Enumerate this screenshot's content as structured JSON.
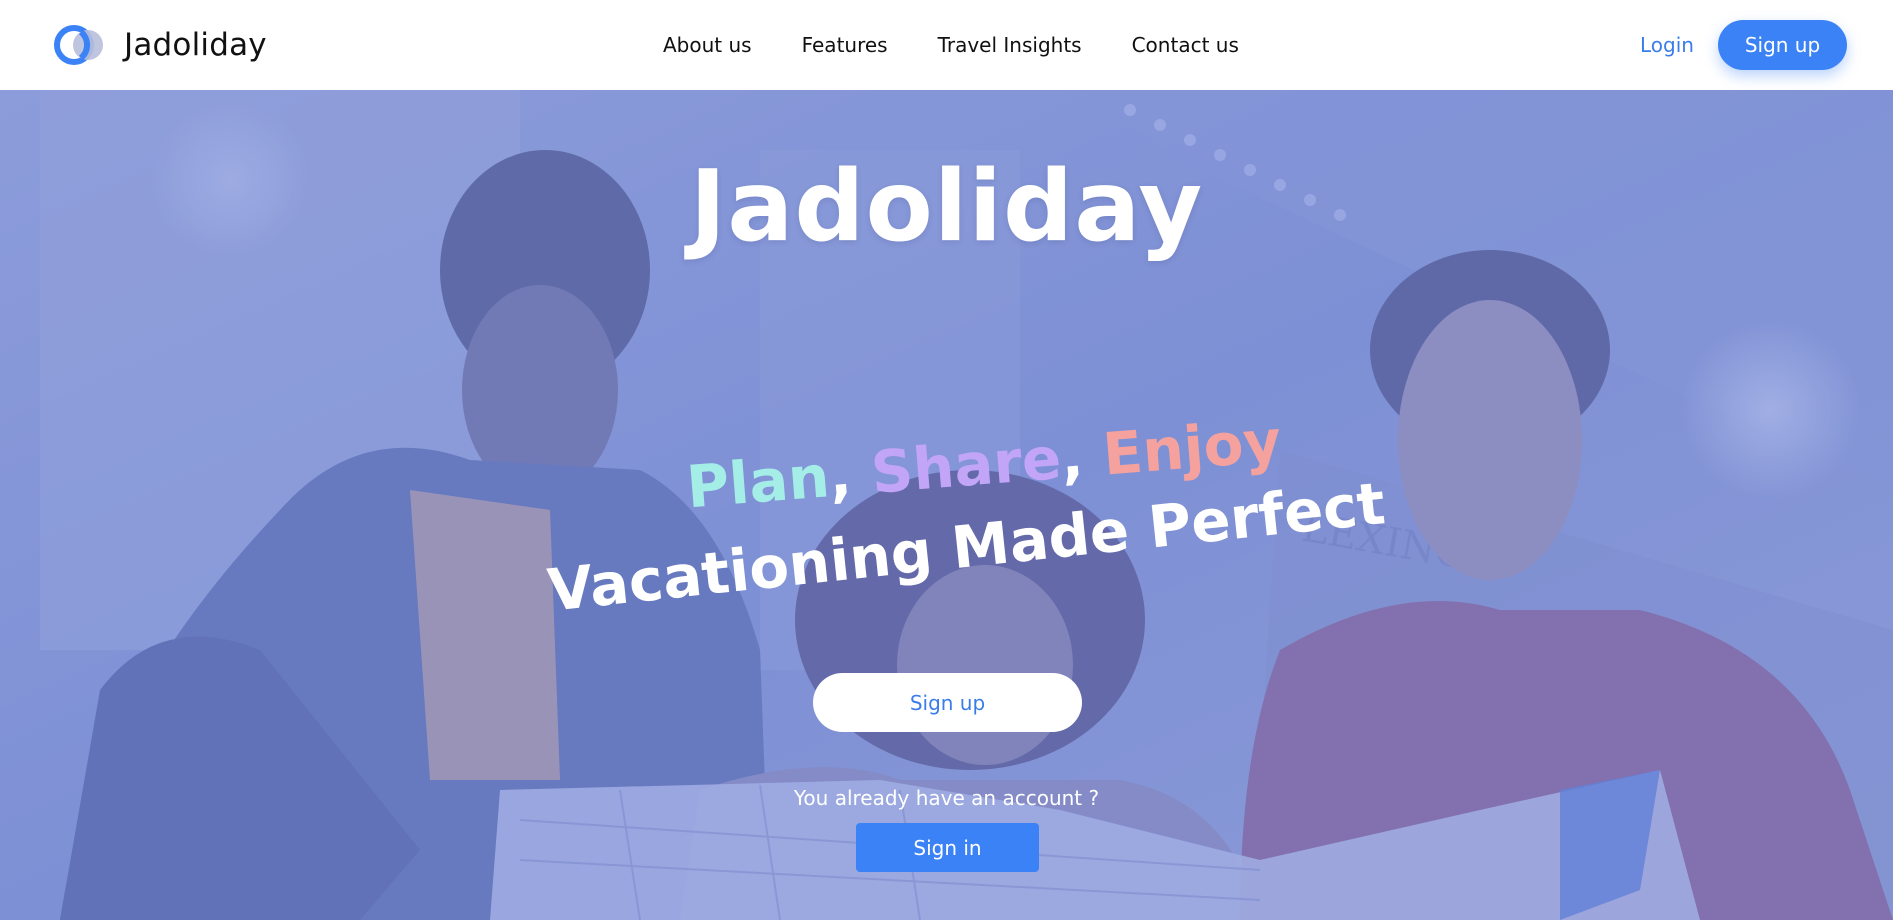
{
  "brand": {
    "name": "Jadoliday",
    "logo_icon": "interlocking-rings-logo"
  },
  "nav": {
    "items": [
      {
        "label": "About us"
      },
      {
        "label": "Features"
      },
      {
        "label": "Travel Insights"
      },
      {
        "label": "Contact us"
      }
    ]
  },
  "auth": {
    "login_label": "Login",
    "signup_label": "Sign up"
  },
  "hero": {
    "title": "Jadoliday",
    "tagline_words": {
      "plan": "Plan",
      "comma1": ",",
      "share": "Share",
      "comma2": ",",
      "enjoy": "Enjoy"
    },
    "subtitle": "Vacationing Made Perfect",
    "signup_label": "Sign up",
    "account_prompt": "You already have an account ?",
    "signin_label": "Sign in",
    "background_icon": "group-reading-map-photo"
  },
  "colors": {
    "accent": "#3b82f6",
    "plan": "#a5eee7",
    "share": "#c3a5f7",
    "enjoy": "#f5a29e",
    "hero_tint": "#8a9cd6"
  }
}
